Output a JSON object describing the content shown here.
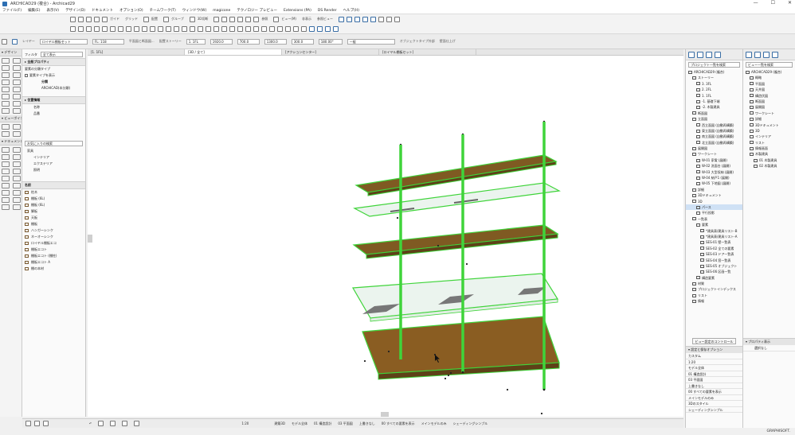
{
  "window": {
    "title": "ARCHICAD29 (複合) - Archicad29",
    "controls": [
      "—",
      "☐",
      "✕"
    ]
  },
  "menu": [
    "ファイル(F)",
    "編集(E)",
    "表示(V)",
    "デザイン(D)",
    "ドキュメント",
    "オプション(O)",
    "チームワーク(T)",
    "ウィンドウ(W)",
    "magicone",
    "テクノロジー プレビュー",
    "Extensions (PA)",
    "DS Render",
    "ヘルプ(H)"
  ],
  "toolbar1": {
    "labels": [
      "ガイド",
      "グリッド",
      "配置",
      "グループ",
      "3D切断",
      "参照",
      "ビュー(M)",
      "非表示",
      "参照ビュー"
    ]
  },
  "infobar": {
    "layer_label": "レイヤー",
    "layer_value": "ロイヤル棚板セット",
    "floor_value": "FL: 118",
    "plan_label": "平面図と断面図...",
    "home_story_label": "配置ストーリー",
    "home_story_value": "1. 1FL",
    "dim1": "1920.0",
    "dim2": "1300.0",
    "dim3": "700.0",
    "dim4": "300.0",
    "angle": "180.00°",
    "pen": "一般",
    "object_label": "オブジェクトタイプ外部",
    "finish_label": "壁面仕上げ"
  },
  "toolbox": {
    "design_header": "▾ デザイン",
    "viewpoint_header": "▾ ビューポイント",
    "doc_header": "▾ ドキュメント"
  },
  "left_panel": {
    "filter_label": "フィルタ",
    "filter_value": "全て表示",
    "section_favorites": "▸ 全般プロパティ",
    "select_label": "要素の分類タイプ",
    "checkbox_label": "要素タイプを表示",
    "classification_header": "分類",
    "classification_value": "ARCHICAD(本分類)",
    "section_location": "▸ 位置情報",
    "loc_items": [
      "名称",
      "品番"
    ],
    "search_placeholder": "お気に入りの検索",
    "tree_root": "家具",
    "tree_children": [
      "インテリア",
      "エクステリア",
      "照明"
    ],
    "name_header": "名前",
    "object_items": [
      "柱木",
      "棚板 (6L)",
      "棚板 (6L)",
      "脚板",
      "天板",
      "棚板",
      "ハンガーシンク",
      "ネーオーシンク",
      "ロイヤル棚板エコ",
      "棚板エコト",
      "棚板エコト (棚柱)",
      "棚板エコト A",
      "棚の本材"
    ]
  },
  "tabs": [
    "[1. 1FL]",
    "[3D / 全て]",
    "[アクションセンター]",
    "[ロイヤル棚板セット]"
  ],
  "status": {
    "undo": "↶",
    "zoom": "1:20",
    "model_view": "建築3D",
    "model_set": "モデル全体",
    "story": "01 構造設計",
    "plan": "03 平面図",
    "scale": "上書きなし",
    "render": "00 すべての要素を表示",
    "renovation": "メインモデルのみ",
    "shading": "シェーディングシンプル"
  },
  "navigator": {
    "search_placeholder": "プロジェクト一覧を検索",
    "items": [
      {
        "label": "ARCHICAD29 (複合)",
        "indent": 0
      },
      {
        "label": "ストーリー",
        "indent": 1
      },
      {
        "label": "3. 3FL",
        "indent": 2
      },
      {
        "label": "2. 2FL",
        "indent": 2
      },
      {
        "label": "1. 1FL",
        "indent": 2
      },
      {
        "label": "-1. 基礎下端",
        "indent": 2
      },
      {
        "label": "-2. 木製建具",
        "indent": 2
      },
      {
        "label": "断面図",
        "indent": 1
      },
      {
        "label": "立面図",
        "indent": 1
      },
      {
        "label": "西立面図 (自動再構築)",
        "indent": 2
      },
      {
        "label": "東立面図 (自動再構築)",
        "indent": 2
      },
      {
        "label": "南立面図 (自動再構築)",
        "indent": 2
      },
      {
        "label": "北立面図 (自動再構築)",
        "indent": 2
      },
      {
        "label": "展開図",
        "indent": 1
      },
      {
        "label": "ワークシート",
        "indent": 1
      },
      {
        "label": "W-01 家電 (展開)",
        "indent": 2
      },
      {
        "label": "W-02 洗面台 (展開)",
        "indent": 2
      },
      {
        "label": "W-03 大型収納 (展開)",
        "indent": 2
      },
      {
        "label": "W-04 納戸1 (展開)",
        "indent": 2
      },
      {
        "label": "W-05 下地図 (展開)",
        "indent": 2
      },
      {
        "label": "詳細",
        "indent": 1
      },
      {
        "label": "3Dドキュメント",
        "indent": 1
      },
      {
        "label": "3D",
        "indent": 1
      },
      {
        "label": "パース",
        "indent": 2,
        "selected": true
      },
      {
        "label": "平行投影",
        "indent": 2
      },
      {
        "label": "一覧表",
        "indent": 1
      },
      {
        "label": "要素",
        "indent": 2
      },
      {
        "label": "*建具表/建具リスト-B",
        "indent": 3
      },
      {
        "label": "*建具表/建具リスト-A",
        "indent": 3
      },
      {
        "label": "SES-01 壁一覧表",
        "indent": 3
      },
      {
        "label": "SES-02 全ての要素",
        "indent": 3
      },
      {
        "label": "SES-03 ドア一覧表",
        "indent": 3
      },
      {
        "label": "SES-04 窓一覧表",
        "indent": 3
      },
      {
        "label": "SES-05 オブジェクト",
        "indent": 3
      },
      {
        "label": "SES-06 区画一覧",
        "indent": 3
      },
      {
        "label": "構造要素",
        "indent": 2
      },
      {
        "label": "材質",
        "indent": 1
      },
      {
        "label": "プロジェクトインデックス",
        "indent": 1
      },
      {
        "label": "リスト",
        "indent": 1
      },
      {
        "label": "情報",
        "indent": 1
      }
    ],
    "settings_button": "ビュー設定のコントロール",
    "props_header": "▾ 設定と保存オプション",
    "props": [
      "カスタム",
      "1:20",
      "モデル全体",
      "01 構造設計",
      "03 平面図",
      "上書きなし",
      "00 すべての要素を表示",
      "メインモデルのみ",
      "3Dのスタイル",
      "シェーディングシンプル"
    ]
  },
  "organizer": {
    "search_placeholder": "ビュー一覧を検索",
    "items": [
      {
        "label": "ARCHICAD29 (複合)",
        "indent": 0
      },
      {
        "label": "概略",
        "indent": 1
      },
      {
        "label": "平面図",
        "indent": 1
      },
      {
        "label": "天井図",
        "indent": 1
      },
      {
        "label": "構造伏図",
        "indent": 1
      },
      {
        "label": "断面図",
        "indent": 1
      },
      {
        "label": "展開図",
        "indent": 1
      },
      {
        "label": "ワークシート",
        "indent": 1
      },
      {
        "label": "詳細",
        "indent": 1
      },
      {
        "label": "3Dドキュメント",
        "indent": 1
      },
      {
        "label": "3D",
        "indent": 1
      },
      {
        "label": "インテリア",
        "indent": 1
      },
      {
        "label": "リスト",
        "indent": 1
      },
      {
        "label": "情報画面",
        "indent": 1
      },
      {
        "label": "木製建具",
        "indent": 1
      },
      {
        "label": "01 木製建具",
        "indent": 2
      },
      {
        "label": "02 木製建具",
        "indent": 2
      }
    ],
    "bottom_header": "▾ プロパティ表示",
    "bottom_value": "選択なし"
  },
  "brand": "GRAPHISOFT.",
  "colors": {
    "selection_green": "#3fd43a",
    "wood": "#8a5d22",
    "accent_blue": "#3a6ea5"
  },
  "scene": {
    "object": "wall-mounted shelving unit with 3 green upright rails, 3 wooden shelves and 2 glass shelves",
    "selected": true
  }
}
